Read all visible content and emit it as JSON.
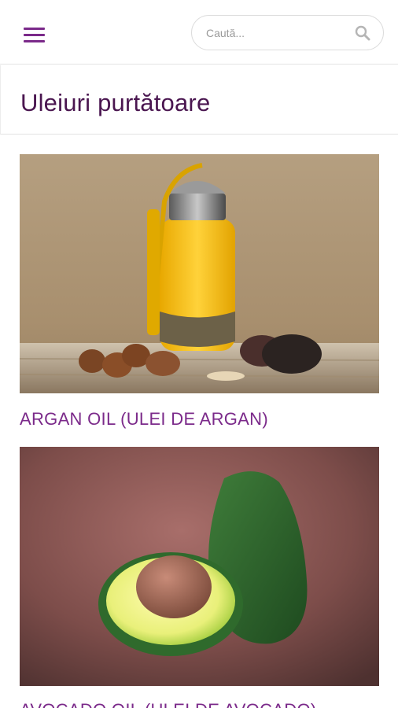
{
  "header": {
    "menu_icon": "hamburger-menu-icon",
    "search_placeholder": "Caută...",
    "search_icon": "search-icon",
    "accent_color": "#7b2a8a"
  },
  "page": {
    "title": "Uleiuri purtătoare",
    "title_color": "#4a1650"
  },
  "products": [
    {
      "title": "ARGAN OIL (ULEI DE ARGAN)",
      "image": "argan oil bottle with argan nuts"
    },
    {
      "title": "AVOCADO OIL (ULEI DE AVOCADO)",
      "image": "halved avocado with pit on burlap"
    }
  ]
}
